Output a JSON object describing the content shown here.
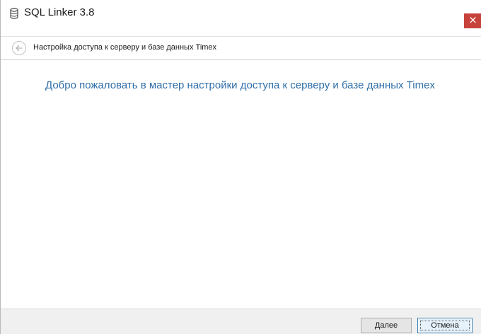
{
  "window": {
    "title": "SQL Linker 3.8",
    "close_glyph": "×",
    "app_icon": "database-icon"
  },
  "navbar": {
    "back_icon": "back-arrow-icon",
    "title": "Настройка доступа к серверу и базе данных Timex"
  },
  "main": {
    "welcome_text": "Добро пожаловать в мастер настройки доступа к серверу и базе данных Timex"
  },
  "footer": {
    "next_label": "Далее",
    "cancel_label": "Отмена"
  },
  "colors": {
    "close_button": "#c7423b",
    "welcome_text": "#2f6ea8",
    "footer_bg": "#f0f0f0"
  }
}
